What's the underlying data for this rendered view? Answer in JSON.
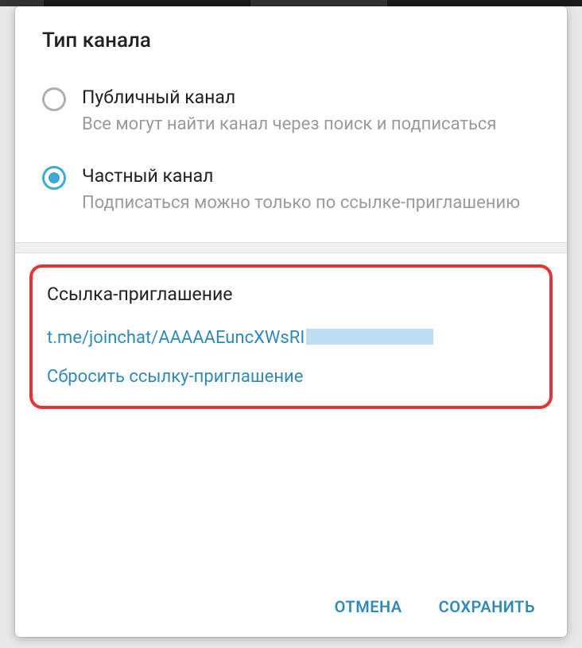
{
  "dialog": {
    "title": "Тип канала"
  },
  "channelType": {
    "options": [
      {
        "label": "Публичный канал",
        "description": "Все могут найти канал через поиск и подписаться"
      },
      {
        "label": "Частный канал",
        "description": "Подписаться можно только по ссылке-приглашению"
      }
    ]
  },
  "inviteSection": {
    "title": "Ссылка-приглашение",
    "link": "t.me/joinchat/AAAAAEuncXWsRI",
    "resetLabel": "Сбросить ссылку-приглашение"
  },
  "footer": {
    "cancel": "ОТМЕНА",
    "save": "СОХРАНИТЬ"
  }
}
